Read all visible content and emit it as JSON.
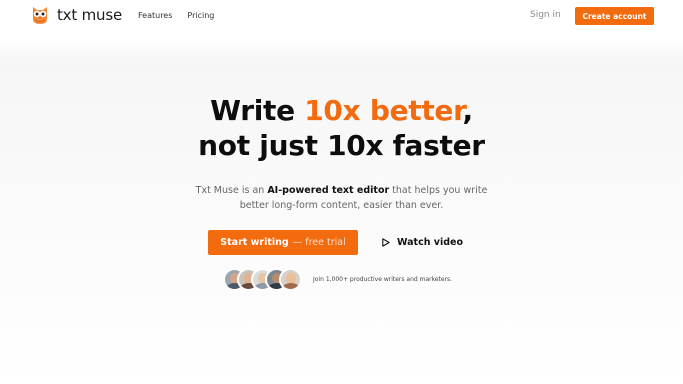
{
  "nav": {
    "brand": "txt muse",
    "links": [
      "Features",
      "Pricing"
    ],
    "signin": "Sign in",
    "create_account": "Create account"
  },
  "hero": {
    "title_line1_pre": "Write ",
    "title_line1_accent": "10x better",
    "title_line1_post": ",",
    "title_line2": "not just 10x faster",
    "sub_pre": "Txt Muse is an ",
    "sub_bold": "AI-powered text editor",
    "sub_post": " that helps you write",
    "sub_line2": "better long-form content, easier than ever.",
    "cta_primary_bold": "Start writing",
    "cta_primary_light": "— free trial",
    "cta_secondary": "Watch video",
    "social_proof": "Join 1,000+ productive writers and marketers."
  },
  "colors": {
    "accent": "#f26b0f",
    "text": "#111111",
    "muted": "#666666"
  },
  "icons": {
    "logo": "owl-logo-icon",
    "play": "play-icon"
  }
}
